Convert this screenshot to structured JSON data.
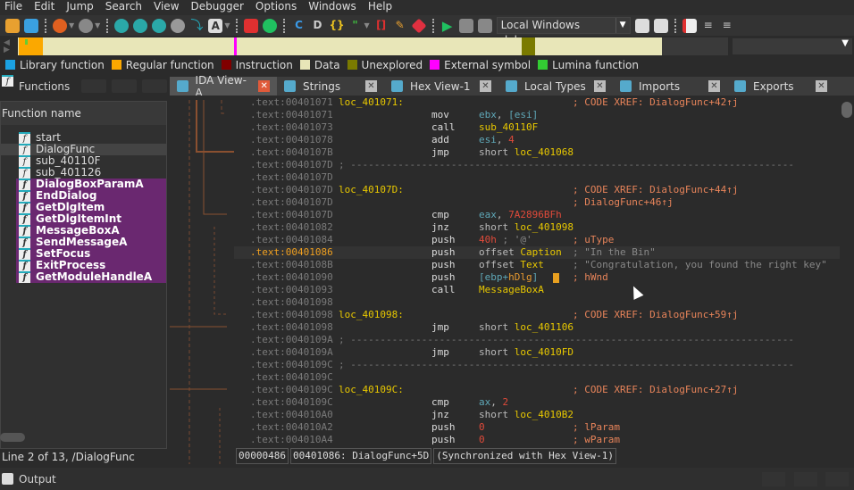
{
  "menu": [
    "File",
    "Edit",
    "Jump",
    "Search",
    "View",
    "Debugger",
    "Options",
    "Windows",
    "Help"
  ],
  "toolbar": {
    "debugger_select": "Local Windows debugge"
  },
  "legend": [
    {
      "label": "Library function",
      "color": "#1ba1e2"
    },
    {
      "label": "Regular function",
      "color": "#fba800"
    },
    {
      "label": "Instruction",
      "color": "#800000"
    },
    {
      "label": "Data",
      "color": "#e8e6b8"
    },
    {
      "label": "Unexplored",
      "color": "#7a7a00"
    },
    {
      "label": "External symbol",
      "color": "#ff00ff"
    },
    {
      "label": "Lumina function",
      "color": "#33cc33"
    }
  ],
  "functions_panel": {
    "title": "Functions",
    "column": "Function name",
    "status": "Line 2 of 13, /DialogFunc",
    "items": [
      {
        "name": "start",
        "kind": "regular"
      },
      {
        "name": "DialogFunc",
        "kind": "selected"
      },
      {
        "name": "sub_40110F",
        "kind": "regular"
      },
      {
        "name": "sub_401126",
        "kind": "regular"
      },
      {
        "name": "DialogBoxParamA",
        "kind": "import"
      },
      {
        "name": "EndDialog",
        "kind": "import"
      },
      {
        "name": "GetDlgItem",
        "kind": "import"
      },
      {
        "name": "GetDlgItemInt",
        "kind": "import"
      },
      {
        "name": "MessageBoxA",
        "kind": "import"
      },
      {
        "name": "SendMessageA",
        "kind": "import"
      },
      {
        "name": "SetFocus",
        "kind": "import"
      },
      {
        "name": "ExitProcess",
        "kind": "import"
      },
      {
        "name": "GetModuleHandleA",
        "kind": "import"
      }
    ]
  },
  "tabs": [
    {
      "label": "IDA View-A",
      "active": true
    },
    {
      "label": "Strings"
    },
    {
      "label": "Hex View-1"
    },
    {
      "label": "Local Types"
    },
    {
      "label": "Imports"
    },
    {
      "label": "Exports"
    }
  ],
  "code": [
    {
      "addr": ".text:00401071",
      "label": "loc_401071:",
      "comment": "; CODE XREF: DialogFunc+42↑j"
    },
    {
      "addr": ".text:00401071",
      "mn": "mov",
      "ops": [
        {
          "t": "reg",
          "v": "ebx"
        },
        {
          "t": "p",
          "v": ", "
        },
        {
          "t": "reg",
          "v": "[esi]"
        }
      ]
    },
    {
      "addr": ".text:00401073",
      "mn": "call",
      "ops": [
        {
          "t": "name",
          "v": "sub_40110F"
        }
      ]
    },
    {
      "addr": ".text:00401078",
      "mn": "add",
      "ops": [
        {
          "t": "reg",
          "v": "esi"
        },
        {
          "t": "p",
          "v": ", "
        },
        {
          "t": "num",
          "v": "4"
        }
      ]
    },
    {
      "addr": ".text:0040107B",
      "mn": "jmp",
      "ops": [
        {
          "t": "kw",
          "v": "short "
        },
        {
          "t": "name",
          "v": "loc_401068"
        }
      ]
    },
    {
      "addr": ".text:0040107D",
      "sep": "; ---------------------------------------------------------------------------"
    },
    {
      "addr": ".text:0040107D"
    },
    {
      "addr": ".text:0040107D",
      "label": "loc_40107D:",
      "comment": "; CODE XREF: DialogFunc+44↑j"
    },
    {
      "addr": ".text:0040107D",
      "comment": "; DialogFunc+46↑j"
    },
    {
      "addr": ".text:0040107D",
      "mn": "cmp",
      "ops": [
        {
          "t": "reg",
          "v": "eax"
        },
        {
          "t": "p",
          "v": ", "
        },
        {
          "t": "num",
          "v": "7A2896BFh"
        }
      ]
    },
    {
      "addr": ".text:00401082",
      "mn": "jnz",
      "ops": [
        {
          "t": "kw",
          "v": "short "
        },
        {
          "t": "name",
          "v": "loc_401098"
        }
      ]
    },
    {
      "addr": ".text:00401084",
      "mn": "push",
      "ops": [
        {
          "t": "num",
          "v": "40h"
        },
        {
          "t": "cmtg",
          "v": " ; '@'"
        }
      ],
      "comment": "; uType"
    },
    {
      "addr": ".text:00401086",
      "mn": "push",
      "ops": [
        {
          "t": "kw",
          "v": "offset "
        },
        {
          "t": "name",
          "v": "Caption"
        }
      ],
      "comment": "; \"In the Bin\"",
      "comment_gray": true,
      "highlight": true
    },
    {
      "addr": ".text:0040108B",
      "mn": "push",
      "ops": [
        {
          "t": "kw",
          "v": "offset "
        },
        {
          "t": "name",
          "v": "Text"
        }
      ],
      "comment": "; \"Congratulation, you found the right key\"",
      "comment_gray": true
    },
    {
      "addr": ".text:00401090",
      "mn": "push",
      "ops": [
        {
          "t": "reg",
          "v": "[ebp+"
        },
        {
          "t": "var",
          "v": "hDlg"
        },
        {
          "t": "reg",
          "v": "]"
        }
      ],
      "comment": "; hWnd"
    },
    {
      "addr": ".text:00401093",
      "mn": "call",
      "ops": [
        {
          "t": "name",
          "v": "MessageBoxA"
        }
      ]
    },
    {
      "addr": ".text:00401098"
    },
    {
      "addr": ".text:00401098",
      "label": "loc_401098:",
      "comment": "; CODE XREF: DialogFunc+59↑j"
    },
    {
      "addr": ".text:00401098",
      "mn": "jmp",
      "ops": [
        {
          "t": "kw",
          "v": "short "
        },
        {
          "t": "name",
          "v": "loc_401106"
        }
      ]
    },
    {
      "addr": ".text:0040109A",
      "sep": "; ---------------------------------------------------------------------------"
    },
    {
      "addr": ".text:0040109A",
      "mn": "jmp",
      "ops": [
        {
          "t": "kw",
          "v": "short "
        },
        {
          "t": "name",
          "v": "loc_4010FD"
        }
      ]
    },
    {
      "addr": ".text:0040109C",
      "sep": "; ---------------------------------------------------------------------------"
    },
    {
      "addr": ".text:0040109C"
    },
    {
      "addr": ".text:0040109C",
      "label": "loc_40109C:",
      "comment": "; CODE XREF: DialogFunc+27↑j"
    },
    {
      "addr": ".text:0040109C",
      "mn": "cmp",
      "ops": [
        {
          "t": "reg",
          "v": "ax"
        },
        {
          "t": "p",
          "v": ", "
        },
        {
          "t": "num",
          "v": "2"
        }
      ]
    },
    {
      "addr": ".text:004010A0",
      "mn": "jnz",
      "ops": [
        {
          "t": "kw",
          "v": "short "
        },
        {
          "t": "name",
          "v": "loc_4010B2"
        }
      ]
    },
    {
      "addr": ".text:004010A2",
      "mn": "push",
      "ops": [
        {
          "t": "num",
          "v": "0"
        }
      ],
      "comment": "; lParam"
    },
    {
      "addr": ".text:004010A4",
      "mn": "push",
      "ops": [
        {
          "t": "num",
          "v": "0"
        }
      ],
      "comment": "; wParam"
    }
  ],
  "status": {
    "offset": "00000486",
    "location": "00401086: DialogFunc+5D",
    "sync": "(Synchronized with Hex View-1)"
  },
  "output": {
    "title": "Output"
  }
}
